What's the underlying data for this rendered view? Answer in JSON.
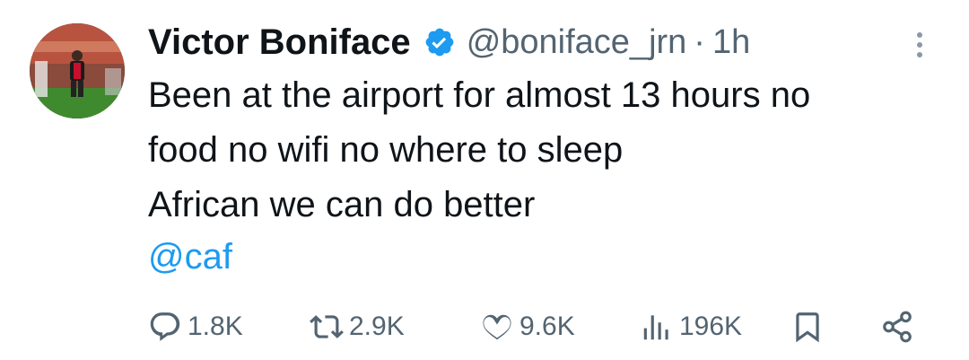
{
  "author": {
    "name": "Victor Boniface",
    "handle": "@boniface_jrn",
    "separator": "·",
    "time": "1h",
    "verified": true
  },
  "tweet": {
    "text": "Been at the airport for almost 13 hours no\nfood no wifi no where to sleep\nAfrican we can do better",
    "mention": "@caf"
  },
  "actions": {
    "replies": "1.8K",
    "reposts": "2.9K",
    "likes": "9.6K",
    "views": "196K"
  },
  "colors": {
    "text": "#0f1419",
    "secondary": "#536471",
    "link": "#1d9bf0",
    "verified": "#1d9bf0"
  },
  "icons": {
    "more": "more-vertical-icon",
    "reply": "reply-icon",
    "repost": "repost-icon",
    "like": "heart-icon",
    "views": "views-icon",
    "bookmark": "bookmark-icon",
    "share": "share-icon"
  }
}
